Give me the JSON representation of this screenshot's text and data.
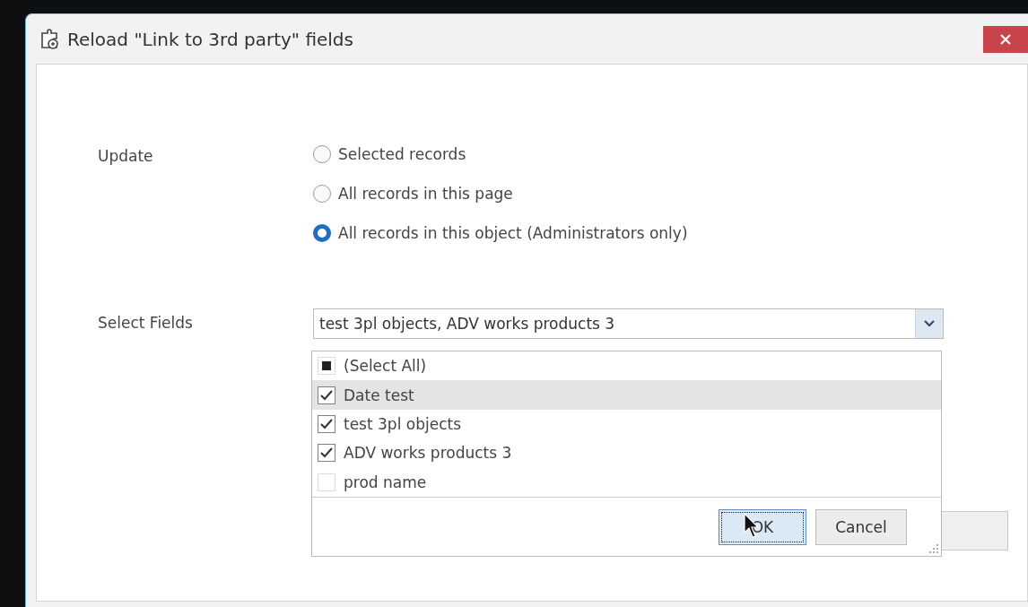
{
  "window": {
    "title": "Reload \"Link to 3rd party\" fields"
  },
  "update": {
    "label": "Update",
    "options": [
      {
        "label": "Selected records",
        "selected": false
      },
      {
        "label": "All records in this page",
        "selected": false
      },
      {
        "label": "All records in this object (Administrators only)",
        "selected": true
      }
    ]
  },
  "select_fields": {
    "label": "Select Fields",
    "value": "test 3pl objects, ADV works products 3",
    "items": [
      {
        "label": "(Select All)",
        "checked": false,
        "indeterminate": true,
        "highlighted": false
      },
      {
        "label": "Date test",
        "checked": true,
        "indeterminate": false,
        "highlighted": true
      },
      {
        "label": "test 3pl objects",
        "checked": true,
        "indeterminate": false,
        "highlighted": false
      },
      {
        "label": "ADV works products 3",
        "checked": true,
        "indeterminate": false,
        "highlighted": false
      },
      {
        "label": "prod name",
        "checked": false,
        "indeterminate": false,
        "highlighted": false
      }
    ],
    "buttons": [
      {
        "label": "OK",
        "focused": true
      },
      {
        "label": "Cancel",
        "focused": false
      }
    ]
  }
}
